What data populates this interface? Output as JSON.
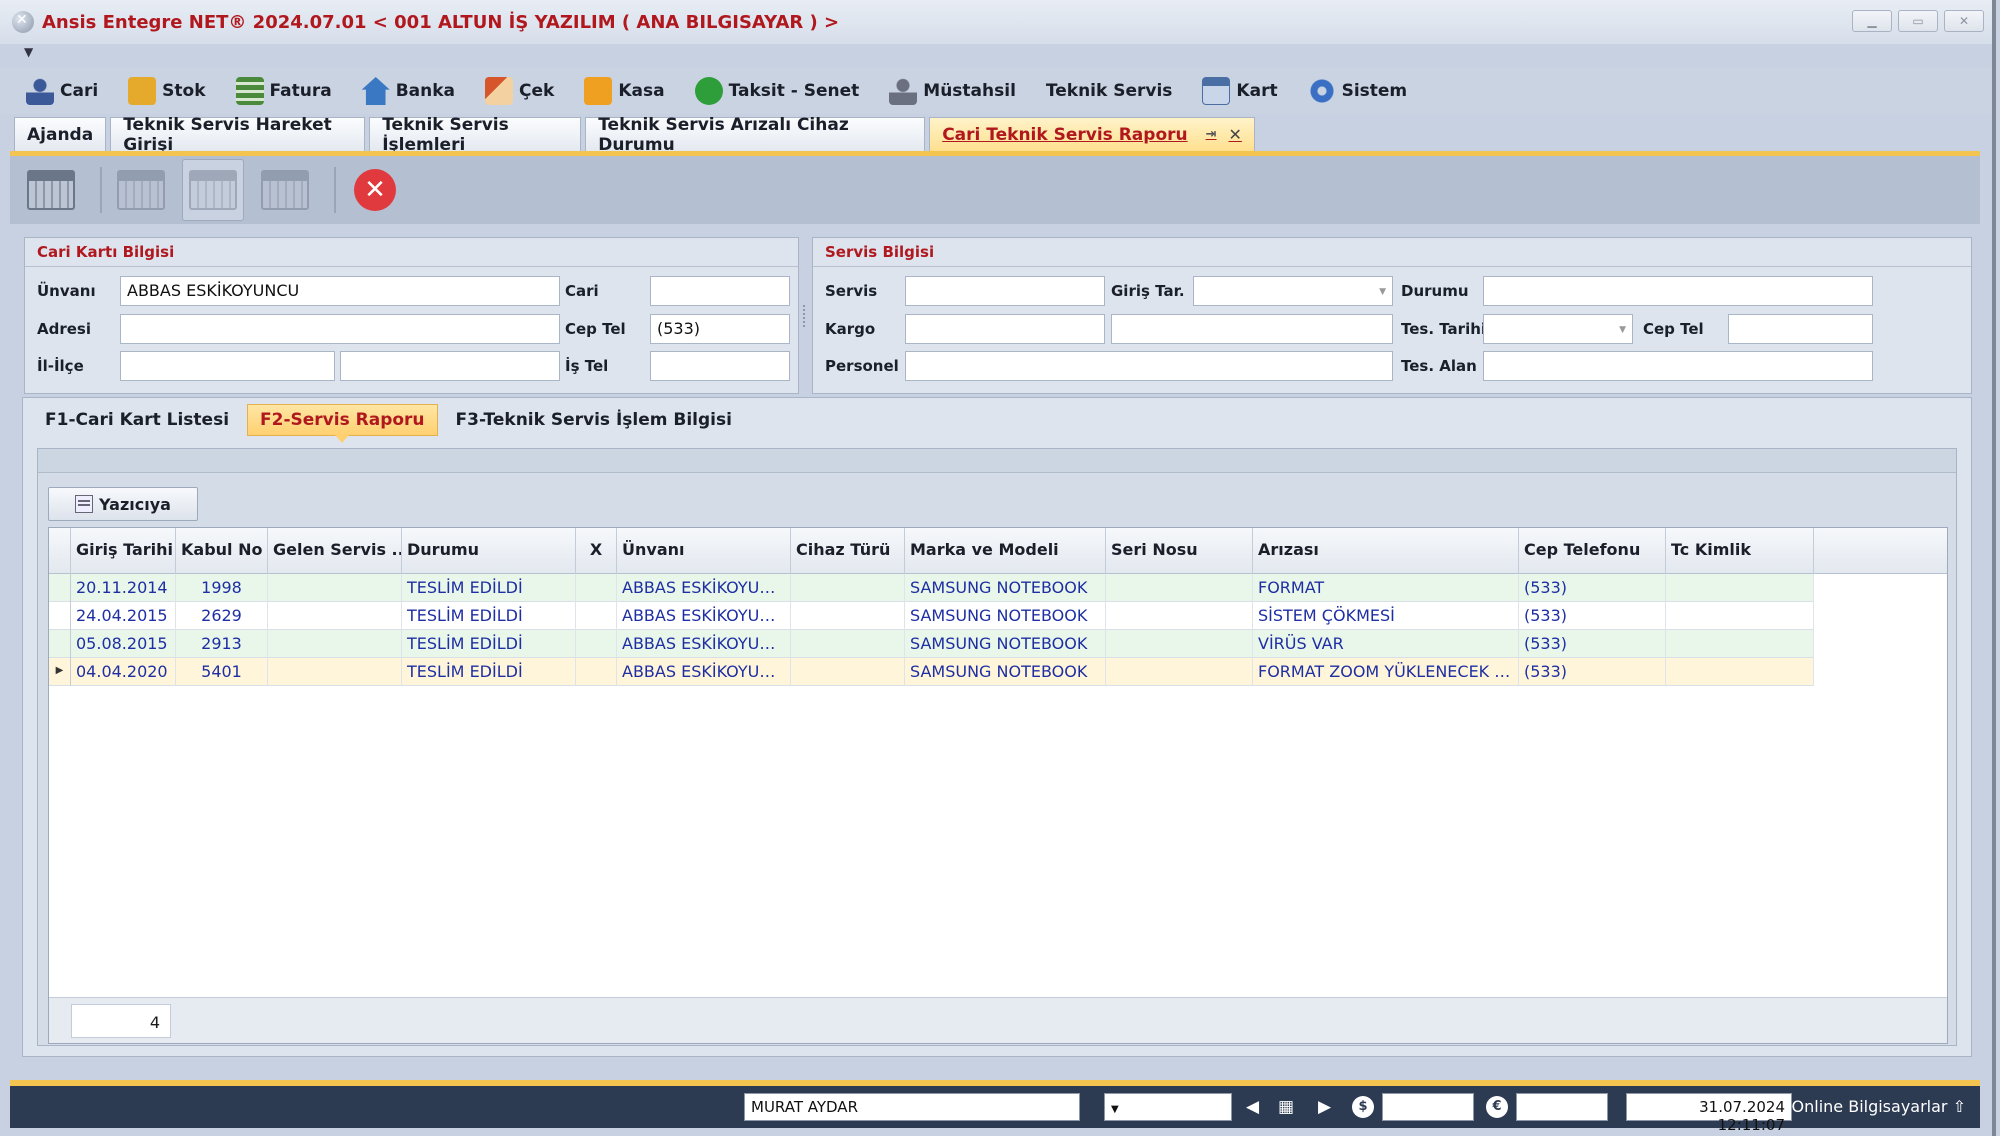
{
  "window": {
    "title": "Ansis Entegre NET® 2024.07.01  < 001 ALTUN İŞ YAZILIM ( ANA BILGISAYAR ) >"
  },
  "menu": [
    {
      "label": "Cari",
      "icon": "user-icon",
      "color": "#3b5998"
    },
    {
      "label": "Stok",
      "icon": "boxes-icon",
      "color": "#e5a92b"
    },
    {
      "label": "Fatura",
      "icon": "invoice-icon",
      "color": "#4a8a3a"
    },
    {
      "label": "Banka",
      "icon": "bank-icon",
      "color": "#3a78c4"
    },
    {
      "label": "Çek",
      "icon": "check-pen-icon",
      "color": "#d6552a"
    },
    {
      "label": "Kasa",
      "icon": "cashbox-icon",
      "color": "#f0a020"
    },
    {
      "label": "Taksit - Senet",
      "icon": "installment-icon",
      "color": "#2e9e3a"
    },
    {
      "label": "Müstahsil",
      "icon": "producer-icon",
      "color": "#6b7080"
    },
    {
      "label": "Teknik Servis",
      "icon": "",
      "color": ""
    },
    {
      "label": "Kart",
      "icon": "card-search-icon",
      "color": "#4a6fa5"
    },
    {
      "label": "Sistem",
      "icon": "gear-icon",
      "color": "#3a6fc4"
    }
  ],
  "doc_tabs": [
    {
      "label": "Ajanda"
    },
    {
      "label": "Teknik Servis Hareket Girişi"
    },
    {
      "label": "Teknik Servis İşlemleri"
    },
    {
      "label": "Teknik Servis Arızalı Cihaz Durumu"
    },
    {
      "label": "Cari Teknik Servis Raporu",
      "active": true
    }
  ],
  "cari_group": {
    "title": "Cari Kartı Bilgisi",
    "unvani_label": "Ünvanı",
    "unvani_value": "ABBAS ESKİKOYUNCU",
    "cari_label": "Cari",
    "cari_value": "",
    "adresi_label": "Adresi",
    "adresi_value": "",
    "ceptel_label": "Cep Tel",
    "ceptel_value": "(533)",
    "ililce_label": "İl-İlçe",
    "il_value": "",
    "ilce_value": "",
    "istel_label": "İş Tel",
    "istel_value": ""
  },
  "servis_group": {
    "title": "Servis Bilgisi",
    "servis_label": "Servis",
    "giris_label": "Giriş Tar.",
    "durumu_label": "Durumu",
    "kargo_label": "Kargo",
    "tes_tarihi_label": "Tes. Tarihi",
    "ceptel_label": "Cep Tel",
    "personel_label": "Personel",
    "tes_alan_label": "Tes. Alan"
  },
  "sub_tabs": [
    {
      "label": "F1-Cari Kart Listesi"
    },
    {
      "label": "F2-Servis Raporu",
      "active": true
    },
    {
      "label": "F3-Teknik Servis İşlem Bilgisi"
    }
  ],
  "print_button": "Yazıcıya",
  "grid": {
    "columns": [
      "Giriş Tarihi",
      "Kabul No",
      "Gelen Servis ...",
      "Durumu",
      "X",
      "Ünvanı",
      "Cihaz Türü",
      "Marka ve Modeli",
      "Seri Nosu",
      "Arızası",
      "Cep Telefonu",
      "Tc Kimlik"
    ],
    "rows": [
      [
        "20.11.2014",
        "1998",
        "",
        "TESLİM EDİLDİ",
        "",
        "ABBAS ESKİKOYUNCU",
        "",
        "SAMSUNG NOTEBOOK",
        "",
        "FORMAT",
        "(533)",
        ""
      ],
      [
        "24.04.2015",
        "2629",
        "",
        "TESLİM EDİLDİ",
        "",
        "ABBAS ESKİKOYUNCU",
        "",
        "SAMSUNG NOTEBOOK",
        "",
        "SİSTEM ÇÖKMESİ",
        "(533)",
        ""
      ],
      [
        "05.08.2015",
        "2913",
        "",
        "TESLİM EDİLDİ",
        "",
        "ABBAS ESKİKOYUNCU",
        "",
        "SAMSUNG NOTEBOOK",
        "",
        "VİRÜS VAR",
        "(533)",
        ""
      ],
      [
        "04.04.2020",
        "5401",
        "",
        "TESLİM EDİLDİ",
        "",
        "ABBAS ESKİKOYUNCU",
        "",
        "SAMSUNG NOTEBOOK",
        "",
        "FORMAT ZOOM YÜKLENECEK EU...",
        "(533)",
        ""
      ]
    ],
    "selected_row": 3,
    "record_count": "4"
  },
  "status": {
    "user": "MURAT AYDAR",
    "datetime": "31.07.2024 12:11:07",
    "online": "Online Bilgisayarlar"
  }
}
